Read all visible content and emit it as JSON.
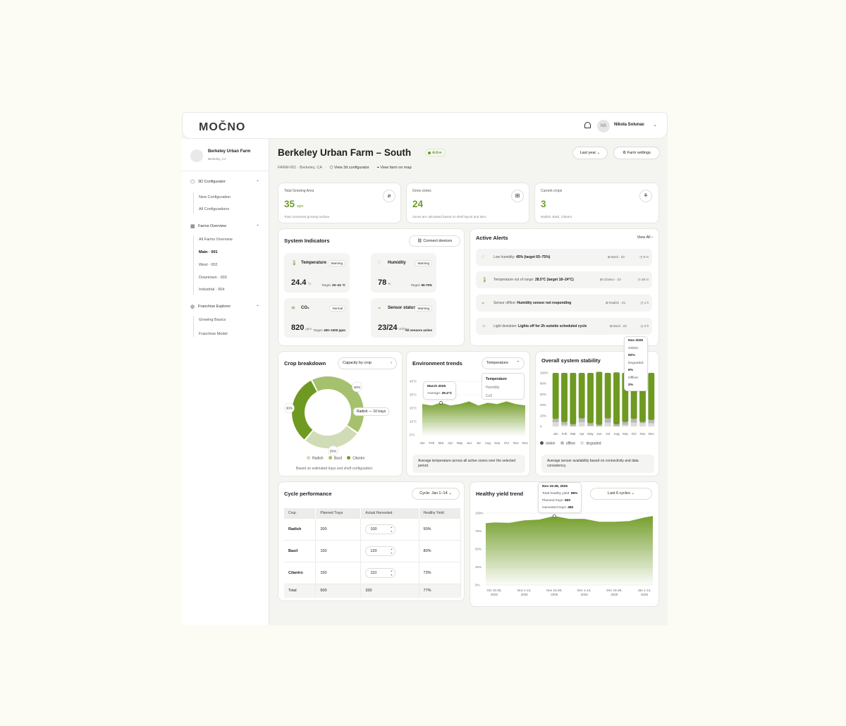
{
  "topbar": {
    "logo": "MOČNO",
    "user_initials": "NS",
    "user_name": "Nikola Solunac"
  },
  "sidebar": {
    "farm_name": "Berkeley Urban Farm",
    "farm_location": "Berkeley, CA",
    "sections": [
      {
        "label": "3D Configurator",
        "items": [
          "New Configuration",
          "All Configurations"
        ]
      },
      {
        "label": "Farms Overview",
        "items": [
          "All Farms Overview",
          "Main · 001",
          "West · 002",
          "Downtown · 003",
          "Industrial · 004"
        ]
      },
      {
        "label": "Franchise Explorer",
        "items": [
          "Growing Basics",
          "Franchise Model"
        ]
      }
    ]
  },
  "header": {
    "title": "Berkeley Urban Farm – South",
    "status": "Active",
    "farm_id": "FARM-001 · Berkeley, CA",
    "link_configurator": "View 3d configurator",
    "link_map": "View farm on map",
    "period_button": "Last year",
    "settings_button": "Farm settings"
  },
  "kpis": [
    {
      "label": "Total Growing Area",
      "value": "35",
      "unit": "sqm",
      "sub": "Total connected growing surface"
    },
    {
      "label": "Grow zones",
      "value": "24",
      "unit": "",
      "sub": "Zones are calculated based on shelf layout and tiers."
    },
    {
      "label": "Current crops",
      "value": "3",
      "unit": "",
      "sub": "Radish, Basil, Cilantro"
    }
  ],
  "system_indicators": {
    "title": "System Indicators",
    "connect_button": "Connect devices",
    "tiles": [
      {
        "name": "Temperature",
        "badge": "Warning",
        "value": "24.4",
        "unit": "°C",
        "target_label": "Target:",
        "target": "20–24 °C"
      },
      {
        "name": "Humidity",
        "badge": "Warning",
        "value": "78",
        "unit": "%",
        "target_label": "Target:",
        "target": "60-70%"
      },
      {
        "name": "CO₂",
        "badge": "Normal",
        "value": "820",
        "unit": "ppm",
        "target_label": "Target:",
        "target": "400–1000 ppm"
      },
      {
        "name": "Sensor status",
        "badge": "Warning",
        "value": "23/24",
        "unit": "online",
        "target_label": "",
        "target": "All sensors active"
      }
    ]
  },
  "alerts": {
    "title": "Active Alerts",
    "view_all": "View All",
    "items": [
      {
        "label": "Low humidity:",
        "detail": "45% (target 65–75%)",
        "zone": "Basil · Z2",
        "time": "8 m"
      },
      {
        "label": "Temperature out of range:",
        "detail": "28.5°C (target 18–24°C)",
        "zone": "Cilantro · Z3",
        "time": "30 m"
      },
      {
        "label": "Sensor offline:",
        "detail": "Humidity sensor not responding",
        "zone": "Radish · Z1",
        "time": "1 h"
      },
      {
        "label": "Light deviation:",
        "detail": "Lights off for 2h outside scheduled cycle",
        "zone": "Basil · Z2",
        "time": "2 h"
      }
    ]
  },
  "crop_breakdown": {
    "title": "Crop breakdown",
    "button": "Capacity by crop",
    "tooltip": "Radish — 10 trays",
    "labels": [
      "40%",
      "30%",
      "25%"
    ],
    "legend": [
      "Radish",
      "Basil",
      "Cilantro"
    ],
    "note": "Based on estimated trays and shelf configuration."
  },
  "env_trends": {
    "title": "Environment trends",
    "dropdown": "Temperature",
    "options": [
      "Temperature",
      "Humidity",
      "Co2"
    ],
    "tooltip_title": "March 2025",
    "tooltip_label": "Average:",
    "tooltip_value": "29.4°C",
    "note": "Average temperature across all active zones over the selected period."
  },
  "stability": {
    "title": "Overall system stability",
    "tooltip_title": "Nov 2025",
    "tooltip_rows": [
      {
        "label": "Online:",
        "value": "92%"
      },
      {
        "label": "Degraded:",
        "value": "6%"
      },
      {
        "label": "Offline:",
        "value": "2%"
      }
    ],
    "legend": [
      "online",
      "offline",
      "degraded"
    ],
    "note": "Average sensor availability based on connectivity and data consistency."
  },
  "cycle": {
    "title": "Cycle performance",
    "dropdown": "Cycle: Jan 1–14",
    "columns": [
      "Crop",
      "Planned Trays",
      "Actual Harvested",
      "Healthy Yield"
    ],
    "rows": [
      {
        "crop": "Radish",
        "planned": "200",
        "actual": "100",
        "yield": "50%"
      },
      {
        "crop": "Basil",
        "planned": "150",
        "actual": "120",
        "yield": "80%"
      },
      {
        "crop": "Cilantro",
        "planned": "150",
        "actual": "110",
        "yield": "73%"
      }
    ],
    "total": {
      "crop": "Total",
      "planned": "500",
      "actual": "330",
      "yield": "77%"
    }
  },
  "yield_trend": {
    "title": "Healthy yield trend",
    "dropdown": "Last 6 cycles",
    "tooltip_title": "Nov 15-28, 2025",
    "tooltip_rows": [
      {
        "label": "Total healthy yield:",
        "value": "96%"
      },
      {
        "label": "Planned trays:",
        "value": "500"
      },
      {
        "label": "Harvested trays:",
        "value": "482"
      }
    ]
  },
  "chart_data": [
    {
      "type": "pie",
      "title": "Crop breakdown",
      "categories": [
        "Radish",
        "Basil",
        "Cilantro"
      ],
      "values": [
        40,
        30,
        25
      ],
      "colors": [
        "#a6c16e",
        "#6e9a22",
        "#cfdcb5"
      ]
    },
    {
      "type": "area",
      "title": "Environment trends",
      "ylabel": "",
      "x": [
        "Jan",
        "Feb",
        "Mar",
        "Apr",
        "May",
        "Jun",
        "Jul",
        "Aug",
        "Sep",
        "Oct",
        "Nov",
        "Dec"
      ],
      "yticks": [
        "0°C",
        "10°C",
        "20°C",
        "30°C",
        "40°C"
      ],
      "ylim": [
        0,
        40
      ],
      "series": [
        {
          "values": [
            23,
            22,
            24,
            22,
            23,
            25,
            22,
            24,
            23,
            25,
            23,
            22
          ]
        }
      ]
    },
    {
      "type": "bar",
      "title": "Overall system stability",
      "categories": [
        "Jan",
        "Feb",
        "Mar",
        "Apr",
        "May",
        "Jun",
        "Jul",
        "Aug",
        "Sep",
        "Oct",
        "Nov",
        "Dec"
      ],
      "yticks": [
        "0",
        "20%",
        "40%",
        "60%",
        "80%",
        "100%"
      ],
      "ylim": [
        0,
        100
      ],
      "series": [
        {
          "name": "online",
          "values": [
            86,
            92,
            96,
            85,
            94,
            99,
            85,
            97,
            92,
            86,
            92,
            88
          ]
        },
        {
          "name": "offline",
          "values": [
            6,
            5,
            4,
            7,
            5,
            3,
            8,
            4,
            5,
            7,
            2,
            6
          ]
        },
        {
          "name": "degraded",
          "values": [
            8,
            3,
            0,
            8,
            1,
            0,
            7,
            0,
            3,
            7,
            6,
            6
          ]
        }
      ],
      "colors": {
        "online": "#6e9a22",
        "offline": "#b9b9b9",
        "degraded": "#dcdcdc"
      }
    },
    {
      "type": "area",
      "title": "Healthy yield trend",
      "x": [
        "Oct 15-28, 2025",
        "Nov 1-14, 2025",
        "Nov 15-28, 2025",
        "Dec 1-14, 2025",
        "Dec 15-28, 2025",
        "Jan 1-14, 2026"
      ],
      "yticks": [
        "0%",
        "25%",
        "50%",
        "75%",
        "100%"
      ],
      "ylim": [
        0,
        100
      ],
      "series": [
        {
          "values": [
            87,
            90,
            96,
            92,
            88,
            94
          ]
        }
      ]
    }
  ]
}
